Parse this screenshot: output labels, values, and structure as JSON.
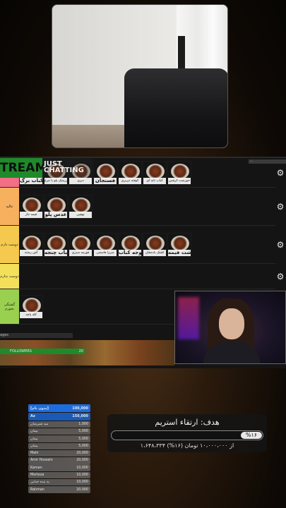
{
  "tier_list": {
    "logo": "TREAM",
    "category": "JUST CHATTING",
    "top_strip_text": "—",
    "gear_icon": "gear-icon",
    "rows": [
      {
        "label": "",
        "color": "#f36f86",
        "items": [
          {
            "caption": "کباب برگ",
            "big": true
          },
          {
            "caption": "زرشک پلو با مرغ",
            "big": false
          },
          {
            "caption": "دیزی",
            "big": false
          },
          {
            "caption": "فسنجان",
            "big": true
          },
          {
            "caption": "کوفته تبریزی",
            "big": false
          },
          {
            "caption": "کباب تابه ای",
            "big": false
          },
          {
            "caption": "خورشت کرفس",
            "big": false
          }
        ]
      },
      {
        "label": "عالیه",
        "color": "#f7b15e",
        "items": [
          {
            "caption": "قیمه نثار",
            "big": false
          },
          {
            "caption": "عدس پلو",
            "big": true
          },
          {
            "caption": "تهچین",
            "big": false
          }
        ]
      },
      {
        "label": "دوست دارم",
        "color": "#f5c94e",
        "items": [
          {
            "caption": "آش رشته",
            "big": false
          },
          {
            "caption": "کباب چنجه",
            "big": true
          },
          {
            "caption": "قورمه سبزی",
            "big": false
          },
          {
            "caption": "میرزا قاسمی",
            "big": false
          },
          {
            "caption": "جوجه کباب",
            "big": true
          },
          {
            "caption": "کشک بادمجان",
            "big": false
          },
          {
            "caption": "خورشت قیمه",
            "big": true
          }
        ]
      },
      {
        "label": "دوست ندارم",
        "color": "#f2e05a",
        "items": []
      },
      {
        "label": "گشنگی بخورم",
        "color": "#9ad04f",
        "items": [
          {
            "caption": "کله پاچه",
            "big": false
          }
        ]
      }
    ],
    "pages_label": "ages",
    "followers_label": "FOLLOWERS",
    "followers_count": "20"
  },
  "leaderboard": [
    {
      "name": "[بدون نام]",
      "amount": "100,000"
    },
    {
      "name": "Az",
      "amount": "150,000"
    },
    {
      "name": "مید شیرینیان",
      "amount": "1,000"
    },
    {
      "name": "پیمان",
      "amount": "5,000"
    },
    {
      "name": "پیمان",
      "amount": "5,000"
    },
    {
      "name": "پیمان",
      "amount": "5,000"
    },
    {
      "name": "Mahi",
      "amount": "20,000"
    },
    {
      "name": "Amir Hossein",
      "amount": "20,000"
    },
    {
      "name": "Kaman",
      "amount": "10,000"
    },
    {
      "name": "Morteza",
      "amount": "10,000"
    },
    {
      "name": "یه بنده خدایی",
      "amount": "10,000"
    },
    {
      "name": "Rahman",
      "amount": "20,000"
    }
  ],
  "goal": {
    "title": "هدف: ارتقاء استریم",
    "percent_text": "%۱۶",
    "progress": 0.16,
    "subtitle": "۱،۶۴۸،۳۳۴ از ۱۰،۰۰۰،۰۰۰ تومان (۱۶%)"
  }
}
